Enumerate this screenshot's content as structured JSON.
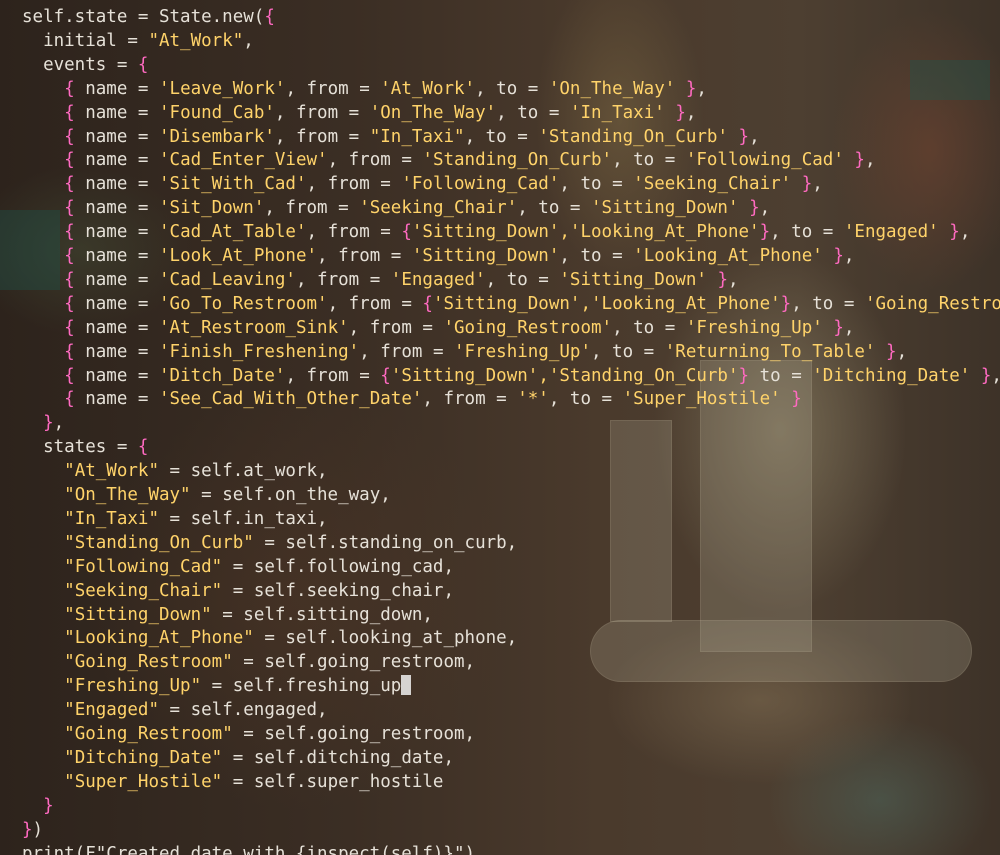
{
  "colors": {
    "brace": "#ff6ac1",
    "string": "#ffd36a",
    "text": "#e6e1d8"
  },
  "code": {
    "line_top": "self.state = State.new({ ... ",
    "initial": "\"At_Work\"",
    "events": [
      [
        "'Leave_Work'",
        "'At_Work'",
        "'On_The_Way'"
      ],
      [
        "'Found_Cab'",
        "'On_The_Way'",
        "'In_Taxi'"
      ],
      [
        "'Disembark'",
        "\"In_Taxi\"",
        "'Standing_On_Curb'"
      ],
      [
        "'Cad_Enter_View'",
        "'Standing_On_Curb'",
        "'Following_Cad'"
      ],
      [
        "'Sit_With_Cad'",
        "'Following_Cad'",
        "'Seeking_Chair'"
      ],
      [
        "'Sit_Down'",
        "'Seeking_Chair'",
        "'Sitting_Down'"
      ],
      [
        "'Cad_At_Table'",
        "{'Sitting_Down','Looking_At_Phone'}",
        "'Engaged'"
      ],
      [
        "'Look_At_Phone'",
        "'Sitting_Down'",
        "'Looking_At_Phone'"
      ],
      [
        "'Cad_Leaving'",
        "'Engaged'",
        "'Sitting_Down'"
      ],
      [
        "'Go_To_Restroom'",
        "{'Sitting_Down','Looking_At_Phone'}",
        "'Going_Restroom'"
      ],
      [
        "'At_Restroom_Sink'",
        "'Going_Restroom'",
        "'Freshing_Up'"
      ],
      [
        "'Finish_Freshening'",
        "'Freshing_Up'",
        "'Returning_To_Table'"
      ],
      [
        "'Ditch_Date'",
        "{'Sitting_Down','Standing_On_Curb'}",
        "'Ditching_Date'"
      ],
      [
        "'See_Cad_With_Other_Date'",
        "'*'",
        "'Super_Hostile'"
      ]
    ],
    "states": [
      [
        "\"At_Work\"",
        "self.at_work,"
      ],
      [
        "\"On_The_Way\"",
        "self.on_the_way,"
      ],
      [
        "\"In_Taxi\"",
        "self.in_taxi,"
      ],
      [
        "\"Standing_On_Curb\"",
        "self.standing_on_curb,"
      ],
      [
        "\"Following_Cad\"",
        "self.following_cad,"
      ],
      [
        "\"Seeking_Chair\"",
        "self.seeking_chair,"
      ],
      [
        "\"Sitting_Down\"",
        "self.sitting_down,"
      ],
      [
        "\"Looking_At_Phone\"",
        "self.looking_at_phone,"
      ],
      [
        "\"Going_Restroom\"",
        "self.going_restroom,"
      ],
      [
        "\"Freshing_Up\"",
        "self.freshing_up,"
      ],
      [
        "\"Engaged\"",
        "self.engaged,"
      ],
      [
        "\"Going_Restroom\"",
        "self.going_restroom,"
      ],
      [
        "\"Ditching_Date\"",
        "self.ditching_date,"
      ],
      [
        "\"Super_Hostile\"",
        "self.super_hostile"
      ]
    ],
    "line_print": "print(F\"Created date with {inspect(self)}\")"
  }
}
